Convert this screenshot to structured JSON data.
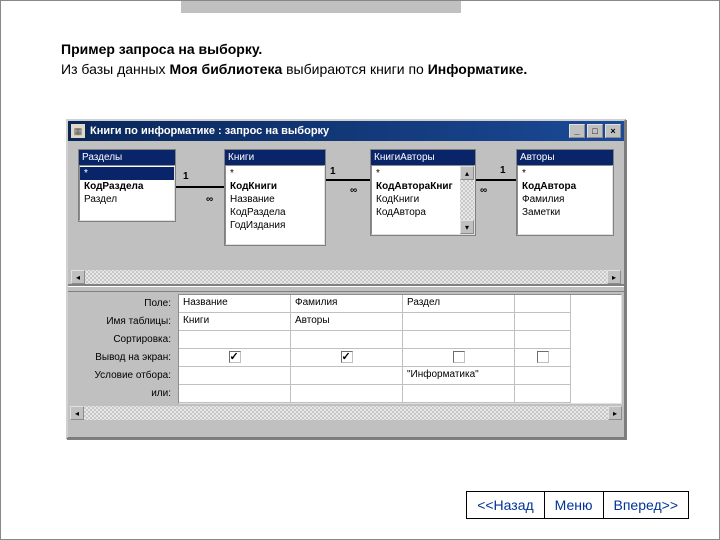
{
  "title": {
    "line1": "Пример запроса на выборку.",
    "line2_prefix": "Из базы данных ",
    "line2_db": "Моя библиотека",
    "line2_mid": " выбираются книги по ",
    "line2_subject": "Информатике."
  },
  "window": {
    "title": "Книги по информатике : запрос на выборку"
  },
  "tables": [
    {
      "title": "Разделы",
      "fields": [
        "*",
        "КодРаздела",
        "Раздел"
      ],
      "selected": 0,
      "bold": [
        1
      ]
    },
    {
      "title": "Книги",
      "fields": [
        "*",
        "КодКниги",
        "Название",
        "КодРаздела",
        "ГодИздания"
      ],
      "bold": [
        1
      ]
    },
    {
      "title": "КнигиАвторы",
      "fields": [
        "*",
        "КодАвтораКниг",
        "КодКниги",
        "КодАвтора"
      ],
      "bold": [
        1
      ]
    },
    {
      "title": "Авторы",
      "fields": [
        "*",
        "КодАвтора",
        "Фамилия",
        "Заметки"
      ],
      "bold": [
        1
      ]
    }
  ],
  "joins": {
    "one": "1",
    "many": "∞"
  },
  "qbe": {
    "labels": [
      "Поле:",
      "Имя таблицы:",
      "Сортировка:",
      "Вывод на экран:",
      "Условие отбора:",
      "или:"
    ],
    "cols": [
      {
        "field": "Название",
        "table": "Книги",
        "sort": "",
        "show": true,
        "criteria": "",
        "or": ""
      },
      {
        "field": "Фамилия",
        "table": "Авторы",
        "sort": "",
        "show": true,
        "criteria": "",
        "or": ""
      },
      {
        "field": "Раздел",
        "table": "",
        "sort": "",
        "show": false,
        "criteria": "\"Информатика\"",
        "or": ""
      }
    ]
  },
  "nav": {
    "back": "<<Назад",
    "menu": "Меню",
    "forward": "Вперед>>"
  }
}
